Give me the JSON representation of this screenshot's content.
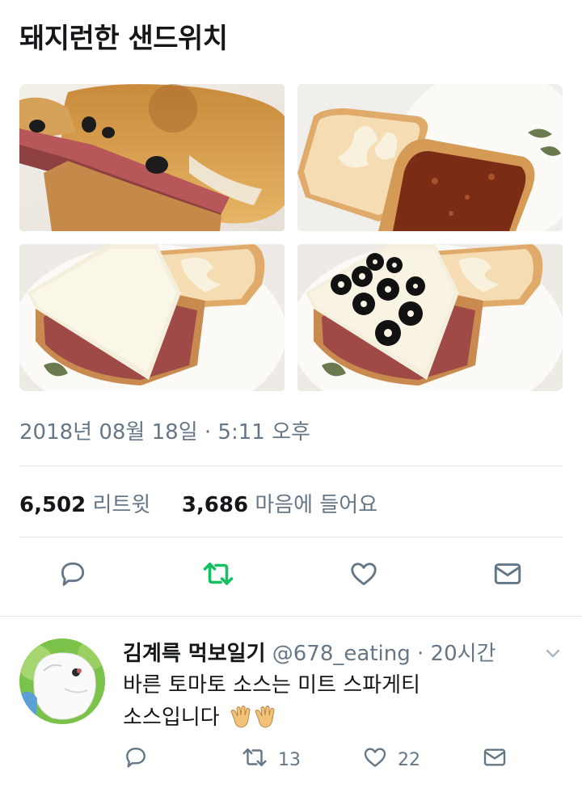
{
  "tweet": {
    "text": "돼지런한 샌드위치",
    "timestamp": "2018년 08월 18일 · 5:11 오후"
  },
  "stats": {
    "retweets_count": "6,502",
    "retweets_label": "리트윗",
    "likes_count": "3,686",
    "likes_label": "마음에 들어요"
  },
  "actions": {
    "reply_icon": "reply-icon",
    "retweet_icon": "retweet-icon",
    "like_icon": "heart-icon",
    "message_icon": "mail-icon"
  },
  "reply": {
    "name": "김계륵 먹보일기",
    "handle": "@678_eating",
    "time": "· 20시간",
    "text_line1": "바른 토마토 소스는 미트 스파게티",
    "text_line2": "소스입니다",
    "retweet_count": "13",
    "like_count": "22"
  },
  "colors": {
    "text": "#14171a",
    "muted": "#657786",
    "divider": "#e1e8ed",
    "retweet_green": "#17bf63",
    "icon_gray": "#657786"
  }
}
